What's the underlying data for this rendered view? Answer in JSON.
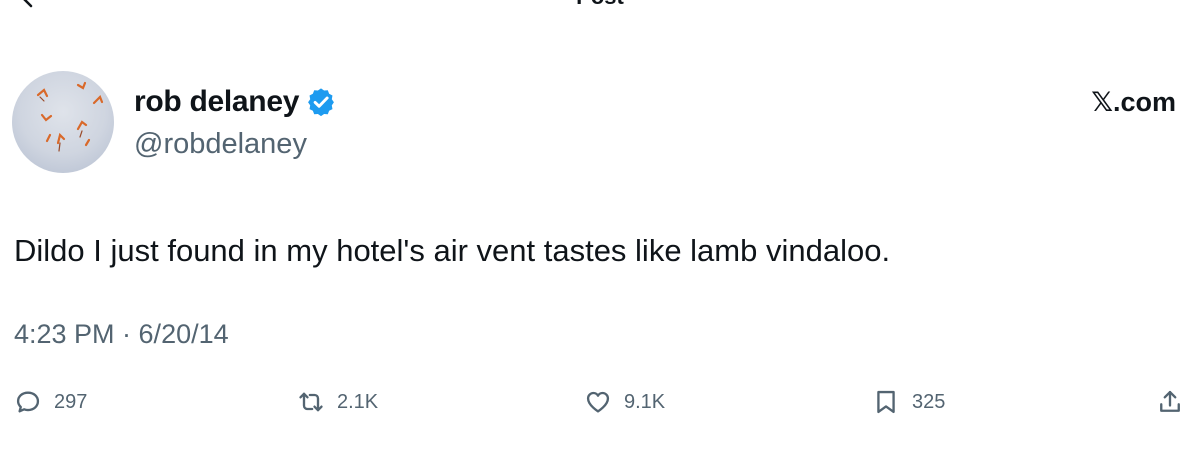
{
  "header": {
    "title": "Post",
    "back_icon": "back-arrow-icon"
  },
  "post": {
    "author_name": "rob delaney",
    "verified": true,
    "verified_color": "#1d9bf0",
    "handle": "@robdelaney",
    "source": "𝕏.com",
    "text": "Dildo I just found in my hotel's air vent tastes like lamb vindaloo.",
    "timestamp": "4:23 PM · 6/20/14"
  },
  "actions": {
    "replies": "297",
    "reposts": "2.1K",
    "likes": "9.1K",
    "bookmarks": "325"
  },
  "colors": {
    "text_primary": "#0f1419",
    "text_secondary": "#536471",
    "background": "#ffffff"
  }
}
